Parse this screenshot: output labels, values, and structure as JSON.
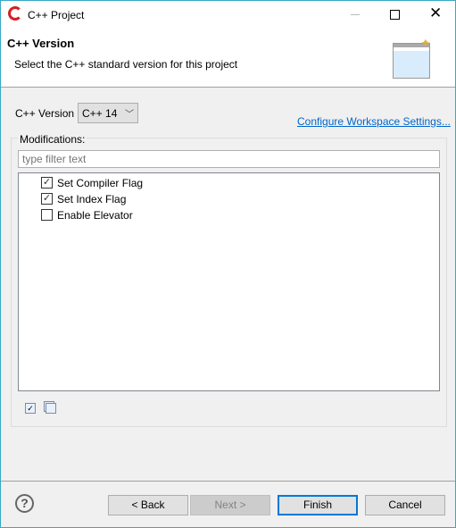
{
  "window": {
    "title": "C++ Project"
  },
  "banner": {
    "title": "C++ Version",
    "subtitle": "Select the C++ standard version for this project"
  },
  "version": {
    "label": "C++ Version",
    "selected": "C++ 14"
  },
  "configure_link": "Configure Workspace Settings...",
  "modifications": {
    "label": "Modifications:",
    "filter_placeholder": "type filter text",
    "items": [
      {
        "label": "Set Compiler Flag",
        "checked": true
      },
      {
        "label": "Set Index Flag",
        "checked": true
      },
      {
        "label": "Enable Elevator",
        "checked": false
      }
    ]
  },
  "buttons": {
    "back": "< Back",
    "next": "Next >",
    "finish": "Finish",
    "cancel": "Cancel"
  },
  "colors": {
    "accent": "#0078d7",
    "link": "#0066cc",
    "border": "#3aa7c4"
  }
}
